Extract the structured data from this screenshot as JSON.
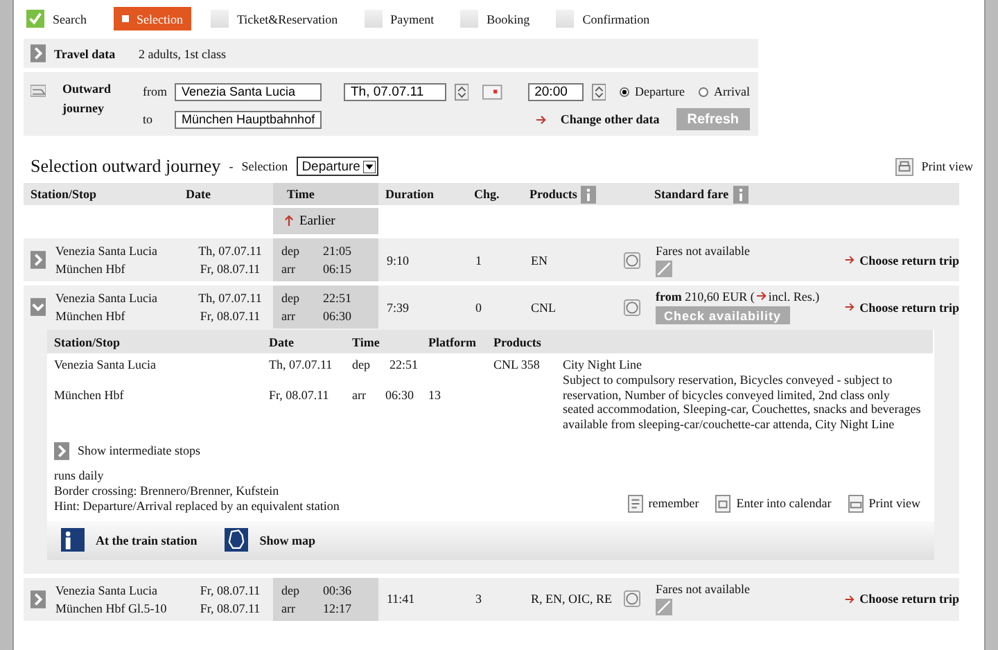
{
  "steps": [
    {
      "label": "Search",
      "selected": false,
      "completed": true
    },
    {
      "label": "Selection",
      "selected": true,
      "completed": false
    },
    {
      "label": "Ticket&Reservation",
      "selected": false,
      "completed": false
    },
    {
      "label": "Payment",
      "selected": false,
      "completed": false
    },
    {
      "label": "Booking",
      "selected": false,
      "completed": false
    },
    {
      "label": "Confirmation",
      "selected": false,
      "completed": false
    }
  ],
  "travel_data": {
    "label": "Travel data",
    "value": "2 adults, 1st class"
  },
  "outward": {
    "label": "Outward journey",
    "from_label": "from",
    "from_value": "Venezia Santa Lucia",
    "to_label": "to",
    "to_value": "München Hauptbahnhof",
    "date": "Th, 07.07.11",
    "time": "20:00",
    "time_mode": [
      {
        "label": "Departure",
        "selected": true
      },
      {
        "label": "Arrival",
        "selected": false
      }
    ],
    "change_link": "Change other data",
    "refresh": "Refresh"
  },
  "selection": {
    "title": "Selection outward journey",
    "separator": "-",
    "select_label": "Selection",
    "select_value": "Departure",
    "print_view": "Print view"
  },
  "table": {
    "columns": [
      {
        "label": "Station/Stop",
        "info": false
      },
      {
        "label": "Date",
        "info": false
      },
      {
        "label": "Time",
        "info": false
      },
      {
        "label": "Duration",
        "info": false
      },
      {
        "label": "Chg.",
        "info": false
      },
      {
        "label": "Products",
        "info": true
      },
      {
        "label": "Standard fare",
        "info": true
      }
    ],
    "earlier": "Earlier",
    "rows": [
      {
        "expanded": false,
        "from": "Venezia Santa Lucia",
        "to": "München Hbf",
        "from_date": "Th, 07.07.11",
        "to_date": "Fr, 08.07.11",
        "dep_label": "dep",
        "dep_time": "21:05",
        "arr_label": "arr",
        "arr_time": "06:15",
        "duration": "9:10",
        "changes": "1",
        "products": "EN",
        "fare": {
          "kind": "unavailable",
          "text": "Fares not available"
        },
        "choose": "Choose return trip"
      },
      {
        "expanded": true,
        "from": "Venezia Santa Lucia",
        "to": "München Hbf",
        "from_date": "Th, 07.07.11",
        "to_date": "Fr, 08.07.11",
        "dep_label": "dep",
        "dep_time": "22:51",
        "arr_label": "arr",
        "arr_time": "06:30",
        "duration": "7:39",
        "changes": "0",
        "products": "CNL",
        "fare": {
          "kind": "price",
          "text": "**from** 210,60 EUR (",
          "link": "incl. Res.)",
          "button": "Check availability"
        },
        "choose": "Choose return trip",
        "detail": {
          "columns": [
            "Station/Stop",
            "Date",
            "Time",
            "Platform",
            "Products"
          ],
          "stops": [
            {
              "station": "Venezia Santa Lucia",
              "date": "Th, 07.07.11",
              "dir": "dep",
              "time": "22:51",
              "product": "CNL 358"
            },
            {
              "station": "München Hbf",
              "date": "Fr, 08.07.11",
              "dir": "arr",
              "time": "06:30",
              "platform": "13"
            }
          ],
          "train_name": "City Night Line",
          "notes": "Subject to compulsory reservation, Bicycles conveyed - subject to reservation, Number of bicycles conveyed limited, 2nd class only seated accommodation, Sleeping-car, Couchettes, snacks and beverages available from sleeping-car/couchette-car attenda, City Night Line",
          "intermediate": "Show intermediate stops",
          "info": [
            "runs daily",
            "Border crossing: Brennero/Brenner, Kufstein",
            "Hint: Departure/Arrival replaced by an equivalent station"
          ],
          "actions": [
            "remember",
            "Enter into calendar",
            "Print view"
          ],
          "station_button": "At the train station",
          "map_button": "Show map"
        }
      },
      {
        "expanded": false,
        "from": "Venezia Santa Lucia",
        "to": "München Hbf Gl.5-10",
        "from_date": "Fr, 08.07.11",
        "to_date": "Fr, 08.07.11",
        "dep_label": "dep",
        "dep_time": "00:36",
        "arr_label": "arr",
        "arr_time": "12:17",
        "duration": "11:41",
        "changes": "3",
        "products": "R, EN, OIC, RE",
        "fare": {
          "kind": "unavailable",
          "text": "Fares not available"
        },
        "choose": "Choose return trip"
      }
    ]
  }
}
